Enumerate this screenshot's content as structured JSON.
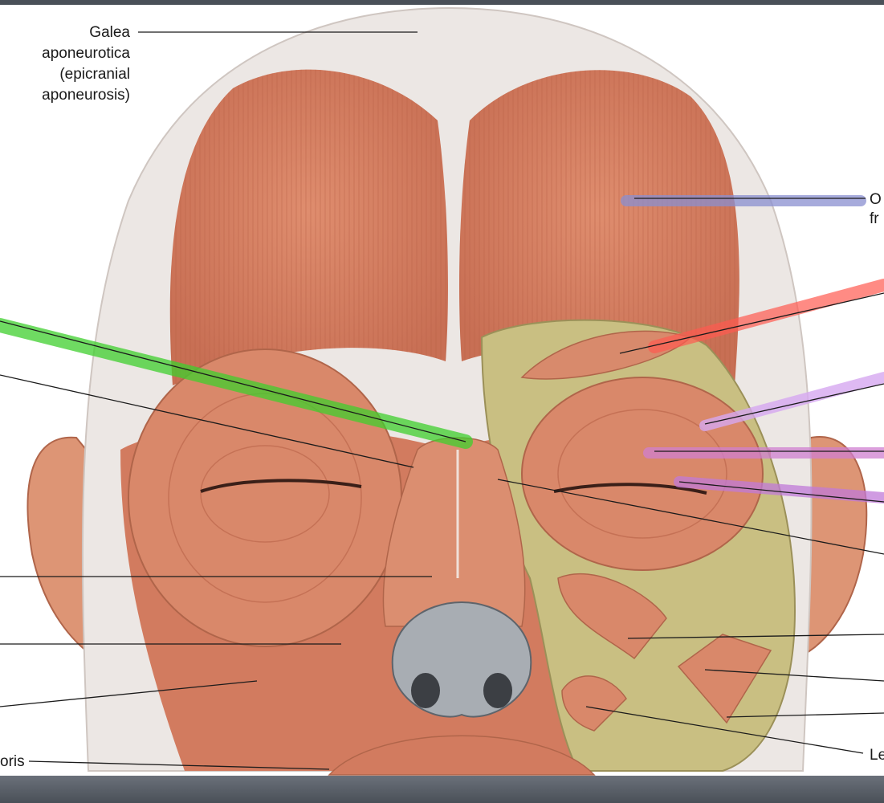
{
  "figure": {
    "labels": {
      "galea": [
        "Galea",
        "aponeurotica",
        "(epicranial",
        "aponeurosis)"
      ],
      "occipitofrontalis": [
        "O",
        "fr"
      ],
      "levator": "Le",
      "oris": "oris"
    },
    "highlight_colors": {
      "frontal_belly": "#8a8fd0",
      "corrugator": "#ff5a50",
      "procerus": "#3fcf2d",
      "orbital_part": "#d6a8f0",
      "palpebral_part": "#cf7fd0",
      "lacrimal_part": "#c07ad8"
    },
    "palette": {
      "muscle": "#d9886a",
      "aponeurosis": "#ece8e6",
      "bone": "#c9bf82",
      "background_top": "#4a5058",
      "footer_band": "#5b616a"
    }
  }
}
